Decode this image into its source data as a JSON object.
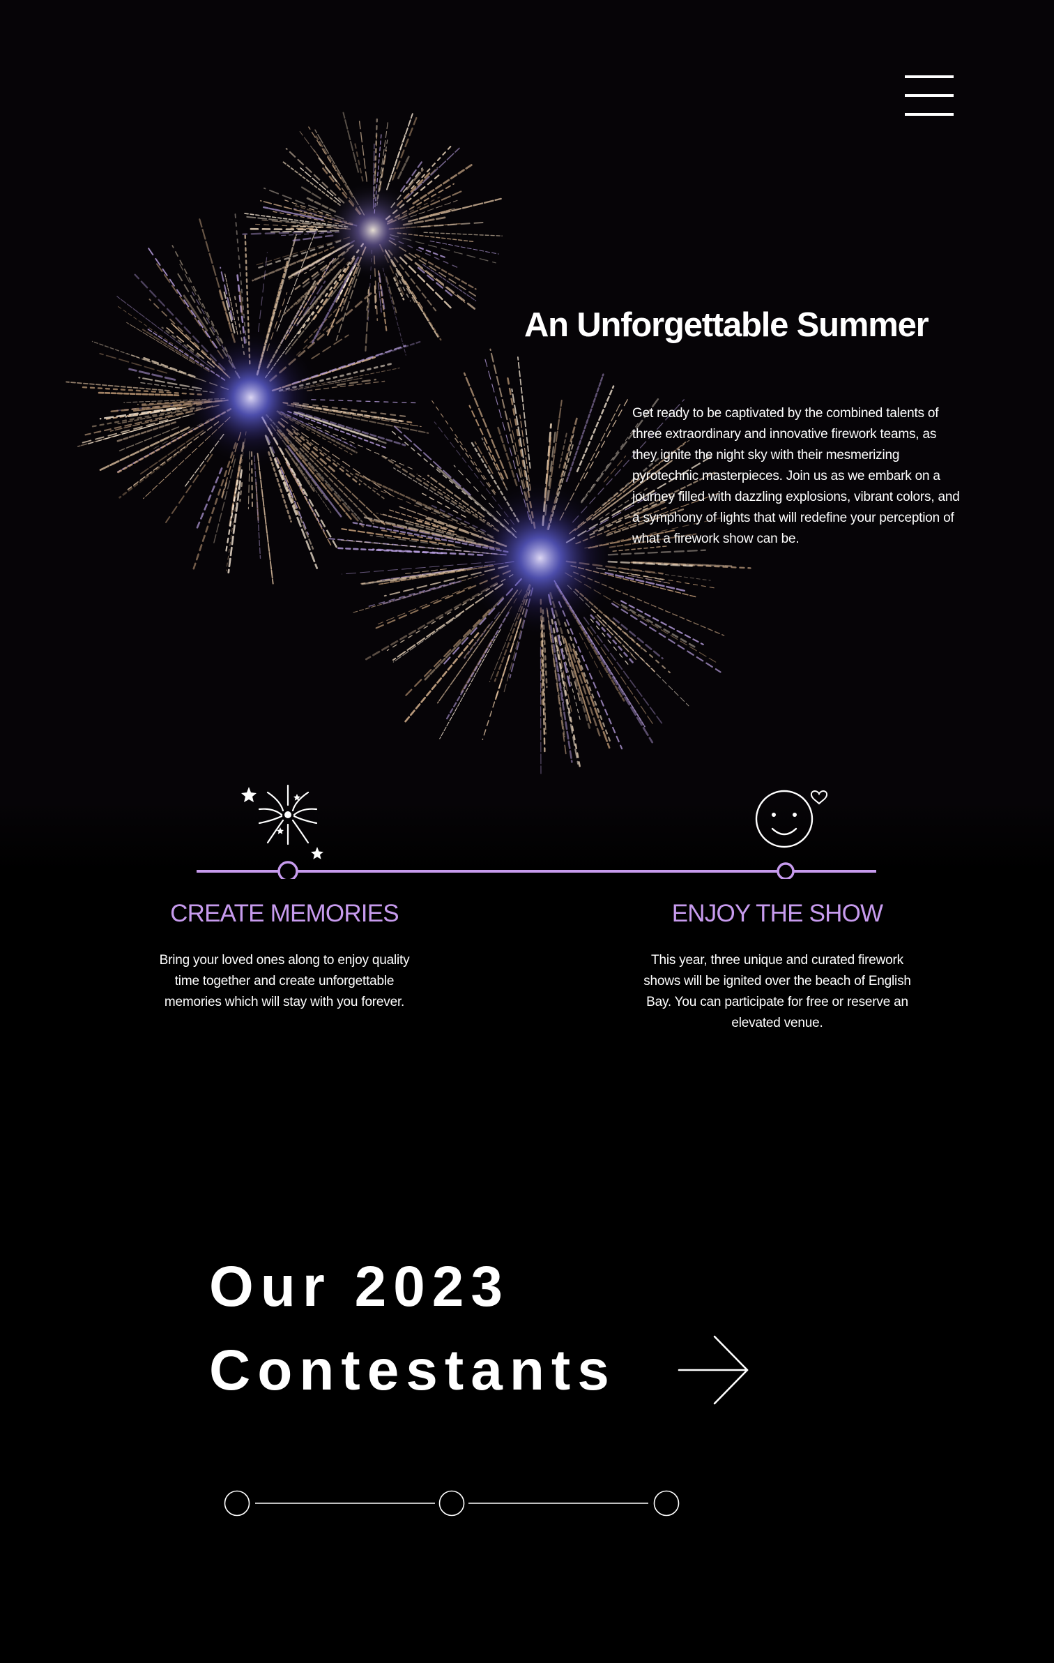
{
  "header": {
    "menu_icon": "hamburger-menu-icon"
  },
  "hero": {
    "title": "An Unforgettable Summer",
    "description": "Get ready to be captivated by the combined talents of three extraordinary and innovative firework teams, as they ignite the night sky with their mesmerizing pyrotechnic masterpieces. Join us as we embark on a journey filled with dazzling explosions, vibrant colors, and a symphony of lights that will redefine your perception of what a firework show can be."
  },
  "features": [
    {
      "icon": "fireworks-icon",
      "heading": "CREATE MEMORIES",
      "text": "Bring your loved ones along to enjoy quality time together and create unforgettable memories which will stay with you forever."
    },
    {
      "icon": "smiley-heart-icon",
      "heading": "ENJOY THE SHOW",
      "text": "This year, three unique and curated firework shows will be ignited over the beach of English Bay. You can participate for free or reserve an elevated venue."
    }
  ],
  "contestants": {
    "heading_line1": "Our 2023",
    "heading_line2": "Contestants",
    "arrow_icon": "arrow-right-icon"
  },
  "colors": {
    "accent": "#c79bee",
    "background": "#000000",
    "text": "#ffffff"
  }
}
